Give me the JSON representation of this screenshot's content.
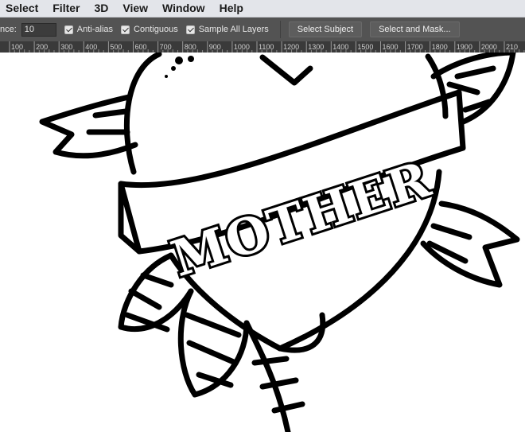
{
  "menu": {
    "items": [
      "Select",
      "Filter",
      "3D",
      "View",
      "Window",
      "Help"
    ]
  },
  "options": {
    "tolerance_label": "nce:",
    "tolerance_value": "10",
    "anti_alias_label": "Anti-alias",
    "contiguous_label": "Contiguous",
    "sample_all_layers_label": "Sample All Layers",
    "select_subject_label": "Select Subject",
    "select_and_mask_label": "Select and Mask..."
  },
  "ruler": {
    "labels": [
      "100",
      "200",
      "300",
      "400",
      "500",
      "600",
      "700",
      "800",
      "900",
      "1000",
      "1100",
      "1200",
      "1300",
      "1400",
      "1500",
      "1600",
      "1700",
      "1800",
      "1900",
      "2000",
      "210"
    ]
  },
  "artwork": {
    "banner_text": "MOTHER"
  },
  "colors": {
    "menubar_bg": "#e3e5ea",
    "options_bg": "#535353",
    "ruler_bg": "#3a3a3a",
    "ink": "#000000",
    "paper": "#ffffff"
  }
}
